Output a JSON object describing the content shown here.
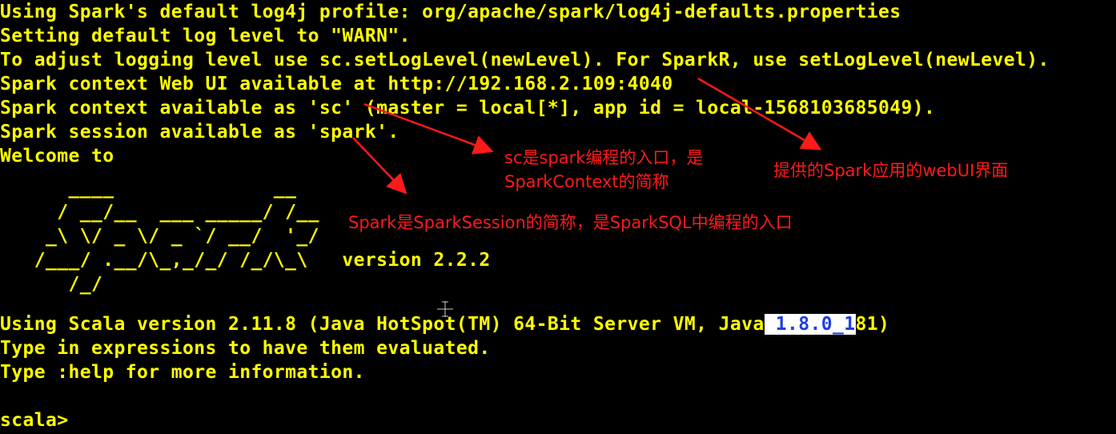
{
  "terminal": {
    "lines": [
      "Using Spark's default log4j profile: org/apache/spark/log4j-defaults.properties",
      "Setting default log level to \"WARN\".",
      "To adjust logging level use sc.setLogLevel(newLevel). For SparkR, use setLogLevel(newLevel).",
      "Spark context Web UI available at http://192.168.2.109:4040",
      "Spark context available as 'sc' (master = local[*], app id = local-1568103685049).",
      "Spark session available as 'spark'.",
      "Welcome to",
      "      ____              __",
      "     / __/__  ___ _____/ /__",
      "    _\\ \\/ _ \\/ _ `/ __/  '_/",
      "   /___/ .__/\\_,_/_/ /_/\\_\\   version 2.2.2",
      "      /_/",
      "",
      "Using Scala version 2.11.8 (Java HotSpot(TM) 64-Bit Server VM, Java",
      "Type in expressions to have them evaluated.",
      "Type :help for more information.",
      "",
      "scala>"
    ],
    "java_version_selected": " 1.8.0_1",
    "java_version_rest": "81)"
  },
  "annotations": {
    "sc_note": "sc是spark编程的入口，是\nSparkContext的简称",
    "webui_note": "提供的Spark应用的webUI界面",
    "spark_note": "Spark是SparkSession的简称，是SparkSQL中编程的入口"
  },
  "colors": {
    "background": "#000000",
    "text": "#ffff00",
    "annotation": "#ff1a1a",
    "selection_bg": "#ffffff",
    "selection_fg": "#1f3fe0"
  }
}
